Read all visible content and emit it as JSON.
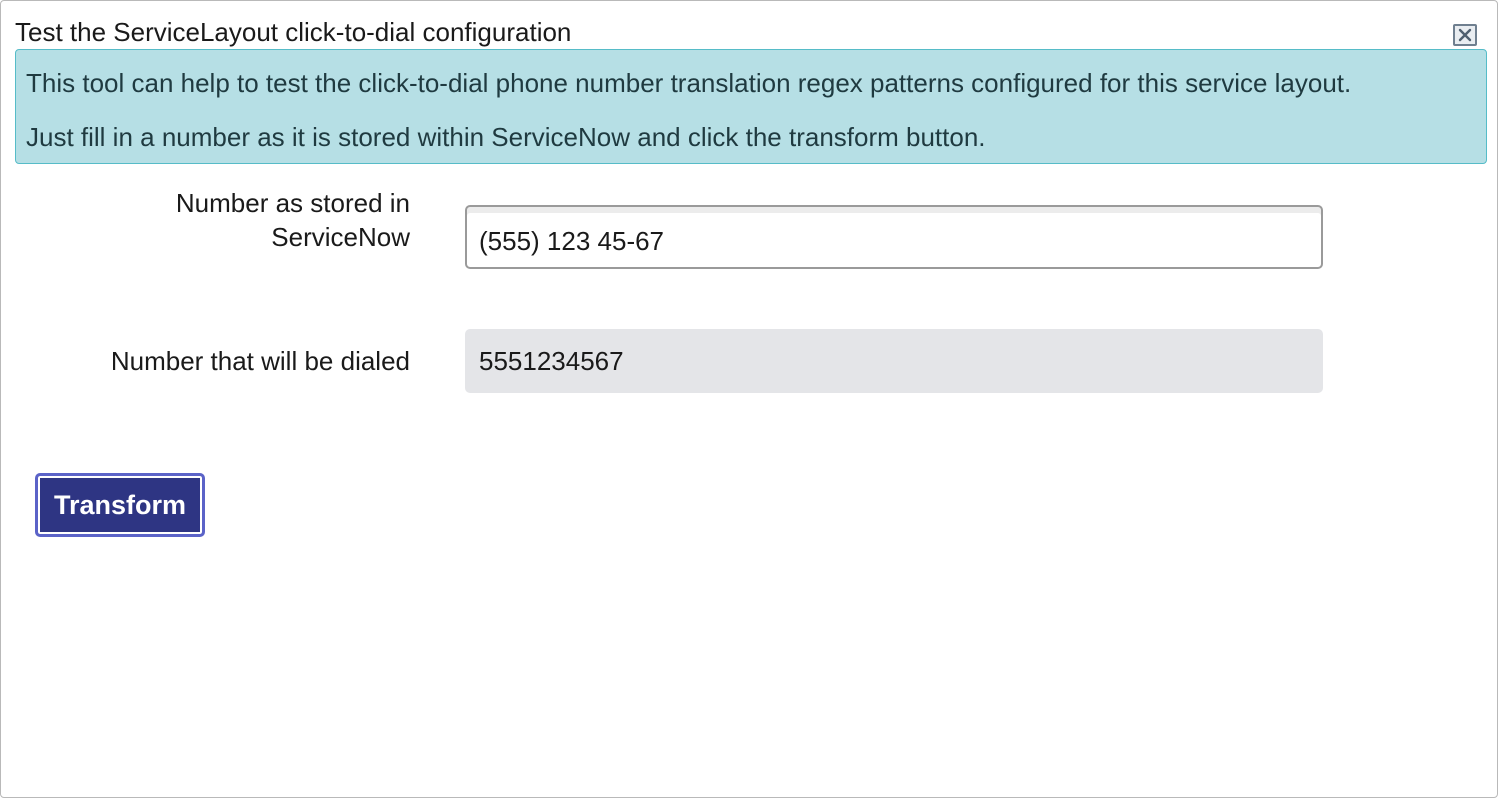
{
  "dialog": {
    "title": "Test the ServiceLayout click-to-dial configuration",
    "close_icon": "close-icon"
  },
  "info": {
    "line1": "This tool can help to test the click-to-dial phone number translation regex patterns configured for this service layout.",
    "line2": "Just fill in a number as it is stored within ServiceNow and click the transform button."
  },
  "form": {
    "source_label": "Number as stored in ServiceNow",
    "source_value": "(555) 123 45-67",
    "dialed_label": "Number that will be dialed",
    "dialed_value": "5551234567",
    "transform_label": "Transform"
  },
  "colors": {
    "info_background": "#b6dfe5",
    "info_border": "#56bcc8",
    "primary_button": "#2e3583"
  }
}
